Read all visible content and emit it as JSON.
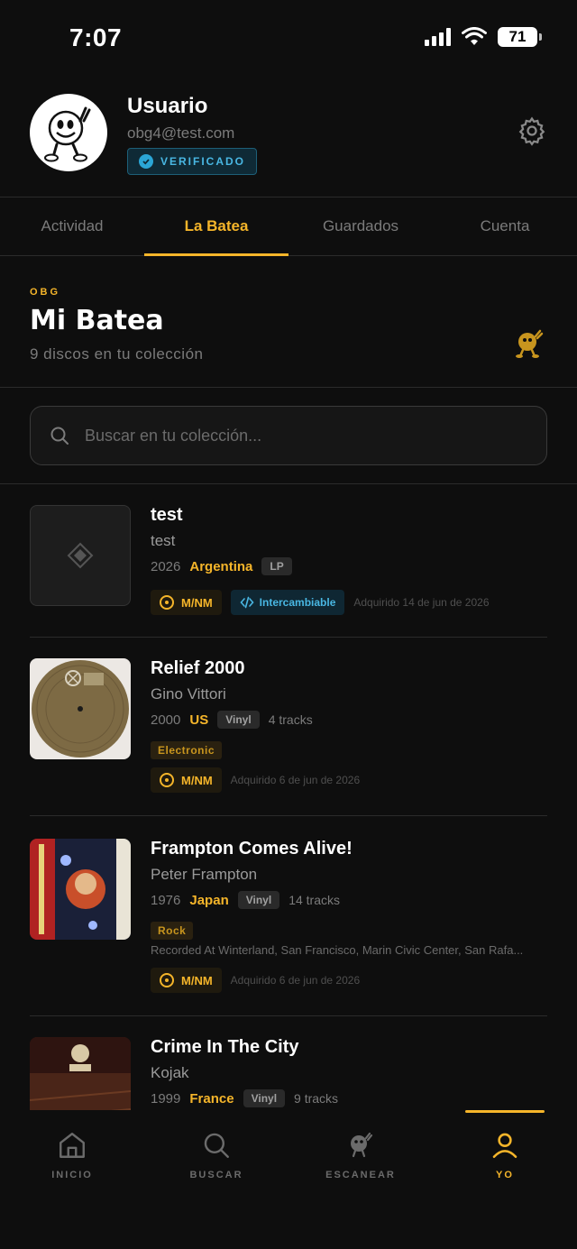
{
  "status_bar": {
    "time": "7:07",
    "battery": "71"
  },
  "profile": {
    "name": "Usuario",
    "email": "obg4@test.com",
    "badge": "VERIFICADO"
  },
  "tabs": [
    {
      "label": "Actividad",
      "active": false
    },
    {
      "label": "La Batea",
      "active": true
    },
    {
      "label": "Guardados",
      "active": false
    },
    {
      "label": "Cuenta",
      "active": false
    }
  ],
  "section": {
    "eyebrow": "OBG",
    "title": "Mi Batea",
    "subtitle": "9 discos en tu colección"
  },
  "search": {
    "placeholder": "Buscar en tu colección..."
  },
  "records": [
    {
      "title": "test",
      "artist": "test",
      "year": "2026",
      "country": "Argentina",
      "format": "LP",
      "tracks": "",
      "genre": "",
      "notes": "",
      "condition": "M/NM",
      "trade": "Intercambiable",
      "acquired": "Adquirido 14 de jun de 2026"
    },
    {
      "title": "Relief 2000",
      "artist": "Gino Vittori",
      "year": "2000",
      "country": "US",
      "format": "Vinyl",
      "tracks": "4 tracks",
      "genre": "Electronic",
      "notes": "",
      "condition": "M/NM",
      "trade": "",
      "acquired": "Adquirido 6 de jun de 2026"
    },
    {
      "title": "Frampton Comes Alive!",
      "artist": "Peter Frampton",
      "year": "1976",
      "country": "Japan",
      "format": "Vinyl",
      "tracks": "14 tracks",
      "genre": "Rock",
      "notes": "Recorded At Winterland, San Francisco, Marin Civic Center, San Rafa...",
      "condition": "M/NM",
      "trade": "",
      "acquired": "Adquirido 6 de jun de 2026"
    },
    {
      "title": "Crime In The City",
      "artist": "Kojak",
      "year": "1999",
      "country": "France",
      "format": "Vinyl",
      "tracks": "9 tracks",
      "genre": "",
      "notes": "",
      "condition": "",
      "trade": "",
      "acquired": ""
    }
  ],
  "nav": [
    {
      "label": "INICIO",
      "icon": "home-icon"
    },
    {
      "label": "BUSCAR",
      "icon": "search-icon"
    },
    {
      "label": "ESCANEAR",
      "icon": "scan-icon"
    },
    {
      "label": "YO",
      "icon": "user-icon",
      "active": true
    }
  ],
  "colors": {
    "accent": "#f5b52a",
    "verified": "#49b7e3",
    "background": "#0e0e0e"
  }
}
